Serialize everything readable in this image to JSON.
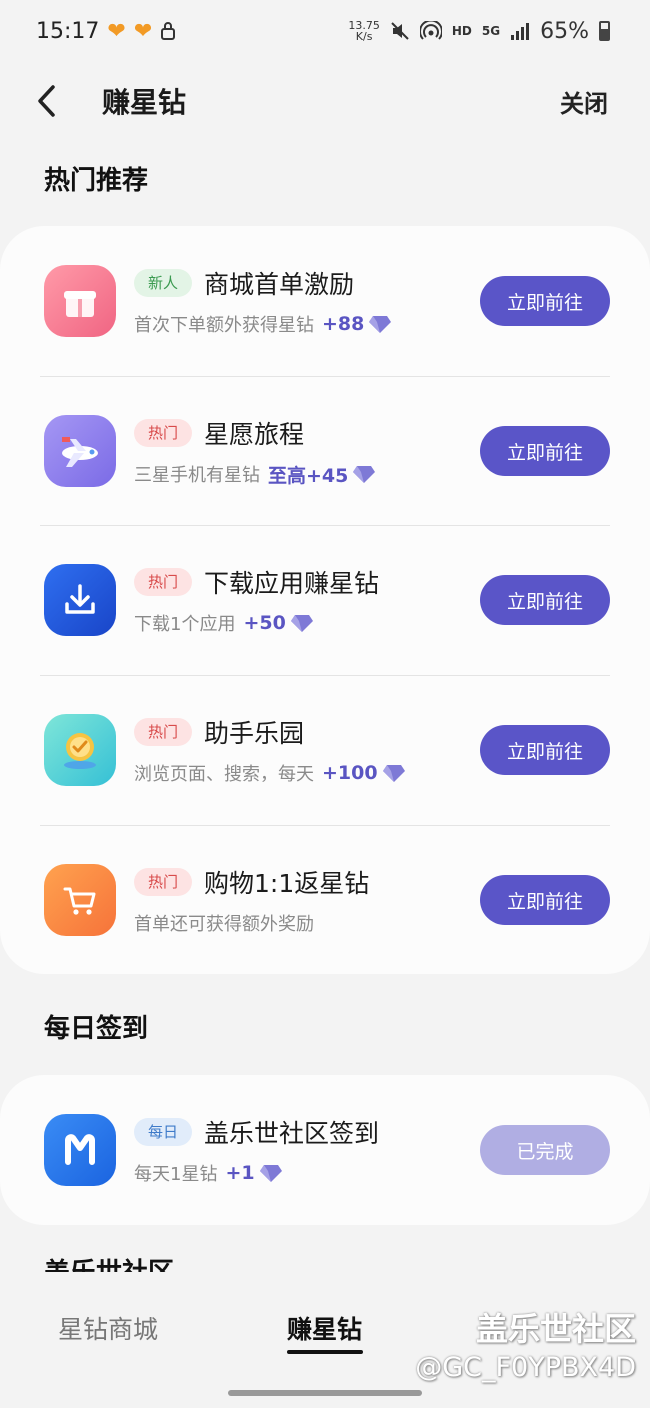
{
  "status": {
    "time": "15:17",
    "net_speed_value": "13.75",
    "net_speed_unit": "K/s",
    "network_hd": "HD",
    "network_5g": "5G",
    "battery": "65%"
  },
  "header": {
    "title": "赚星钻",
    "close_label": "关闭"
  },
  "sections": {
    "hot_title": "热门推荐",
    "daily_title": "每日签到",
    "community_title": "盖乐世社区"
  },
  "hot_tasks": [
    {
      "tag": "新人",
      "title": "商城首单激励",
      "desc": "首次下单额外获得星钻",
      "reward": "+88",
      "button": "立即前往"
    },
    {
      "tag": "热门",
      "title": "星愿旅程",
      "desc": "三星手机有星钻",
      "reward": "至高+45",
      "button": "立即前往"
    },
    {
      "tag": "热门",
      "title": "下载应用赚星钻",
      "desc": "下载1个应用",
      "reward": "+50",
      "button": "立即前往"
    },
    {
      "tag": "热门",
      "title": "助手乐园",
      "desc": "浏览页面、搜索，每天",
      "reward": "+100",
      "button": "立即前往"
    },
    {
      "tag": "热门",
      "title": "购物1:1返星钻",
      "desc": "首单还可获得额外奖励",
      "reward": "",
      "button": "立即前往"
    }
  ],
  "daily_tasks": [
    {
      "tag": "每日",
      "title": "盖乐世社区签到",
      "desc": "每天1星钻",
      "reward": "+1",
      "button": "已完成"
    }
  ],
  "bottom_nav": {
    "shop": "星钻商城",
    "earn": "赚星钻"
  },
  "watermark": {
    "line1": "盖乐世社区",
    "line2": "@GC_F0YPBX4D"
  },
  "colors": {
    "accent": "#5a55c8",
    "reward": "#5a55c2",
    "done": "#b0aee3"
  }
}
